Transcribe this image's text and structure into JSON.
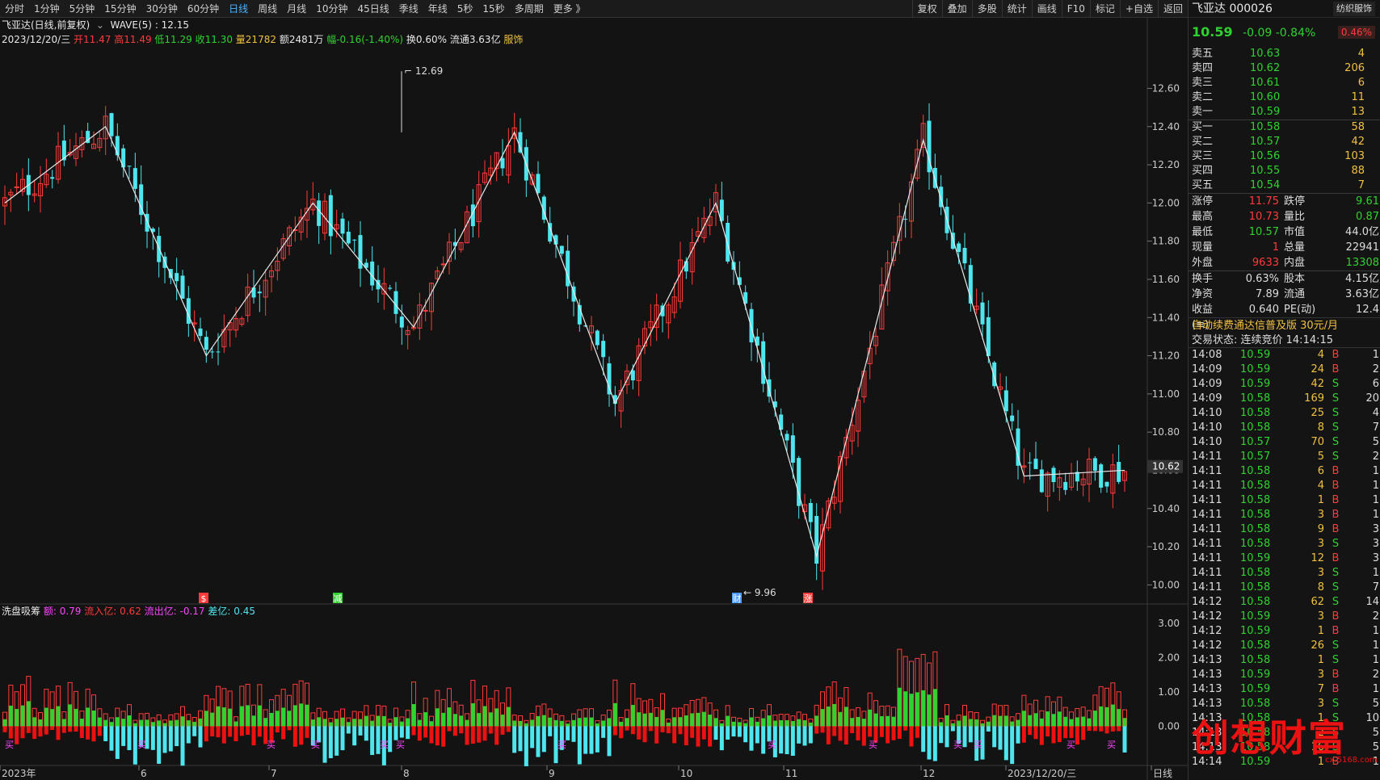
{
  "toolbar": {
    "left_tabs": [
      "分时",
      "1分钟",
      "5分钟",
      "15分钟",
      "30分钟",
      "60分钟",
      "日线",
      "周线",
      "月线",
      "10分钟",
      "45日线",
      "季线",
      "年线",
      "5秒",
      "15秒",
      "多周期",
      "更多 》"
    ],
    "active_tab": "日线",
    "right_tabs": [
      "复权",
      "叠加",
      "多股",
      "统计",
      "画线",
      "F10",
      "标记",
      "+自选",
      "返回"
    ]
  },
  "header": {
    "title": "飞亚达(日线,前复权)",
    "indicator": "WAVE(5)",
    "indicator_value": ": 12.15",
    "date": "2023/12/20/三",
    "open": "开11.47",
    "high": "高11.49",
    "low": "低11.29",
    "close": "收11.30",
    "volume": "量21782",
    "amount": "额2481万",
    "change": "幅-0.16(-1.40%)",
    "turnover": "换0.60%",
    "float": "流通3.63亿",
    "sector": "服饰"
  },
  "indicator_header": {
    "name": "洗盘吸筹",
    "e": "额: 0.79",
    "inflow": "流入亿: 0.62",
    "outflow": "流出亿: -0.17",
    "diff": "差亿: 0.45"
  },
  "chart_data": {
    "type": "candlestick",
    "price_axis": [
      "12.60",
      "12.40",
      "12.20",
      "12.00",
      "11.80",
      "11.60",
      "11.40",
      "11.20",
      "11.00",
      "10.80",
      "10.60",
      "10.40",
      "10.20",
      "10.00"
    ],
    "ylim": [
      9.9,
      12.75
    ],
    "current_price_tag": "10.62",
    "high_label": "12.69",
    "low_label": "9.96",
    "x_labels": [
      "2023年",
      "6",
      "7",
      "8",
      "9",
      "10",
      "11",
      "12",
      "2023/12/20/三",
      "日线"
    ],
    "indicator_axis": [
      "3.00",
      "2.00",
      "1.00",
      "0.00"
    ],
    "indicator_ylim": [
      -1.1,
      3.1
    ],
    "markers": [
      "$",
      "减",
      "财",
      "涨"
    ],
    "buy_label": "买",
    "wave_points": [
      12.0,
      12.4,
      11.2,
      12.0,
      11.35,
      12.37,
      10.95,
      12.0,
      10.15,
      12.33,
      10.57,
      10.6
    ]
  },
  "quote": {
    "name": "飞亚达 000026",
    "industry": "纺织服饰",
    "price": "10.59",
    "change": "-0.09",
    "pct": "-0.84%",
    "badge": "0.46%"
  },
  "asks": [
    {
      "label": "卖五",
      "price": "10.63",
      "vol": "4"
    },
    {
      "label": "卖四",
      "price": "10.62",
      "vol": "206"
    },
    {
      "label": "卖三",
      "price": "10.61",
      "vol": "6"
    },
    {
      "label": "卖二",
      "price": "10.60",
      "vol": "11"
    },
    {
      "label": "卖一",
      "price": "10.59",
      "vol": "13"
    }
  ],
  "bids": [
    {
      "label": "买一",
      "price": "10.58",
      "vol": "58"
    },
    {
      "label": "买二",
      "price": "10.57",
      "vol": "42"
    },
    {
      "label": "买三",
      "price": "10.56",
      "vol": "103"
    },
    {
      "label": "买四",
      "price": "10.55",
      "vol": "88"
    },
    {
      "label": "买五",
      "price": "10.54",
      "vol": "7"
    }
  ],
  "stats": [
    {
      "k": "涨停",
      "v": "11.75",
      "vc": "red",
      "k2": "跌停",
      "v2": "9.61",
      "v2c": "green"
    },
    {
      "k": "最高",
      "v": "10.73",
      "vc": "red",
      "k2": "量比",
      "v2": "0.87",
      "v2c": "green"
    },
    {
      "k": "最低",
      "v": "10.57",
      "vc": "green",
      "k2": "市值",
      "v2": "44.0亿",
      "v2c": "white"
    },
    {
      "k": "现量",
      "v": "1",
      "vc": "red",
      "k2": "总量",
      "v2": "22941",
      "v2c": "white"
    },
    {
      "k": "外盘",
      "v": "9633",
      "vc": "red",
      "k2": "内盘",
      "v2": "13308",
      "v2c": "green"
    }
  ],
  "stats2": [
    {
      "k": "换手",
      "v": "0.63%",
      "k2": "股本",
      "v2": "4.15亿"
    },
    {
      "k": "净资",
      "v": "7.89",
      "k2": "流通",
      "v2": "3.63亿"
    },
    {
      "k": "收益(≡)",
      "v": "0.640",
      "k2": "PE(动)",
      "v2": "12.4"
    }
  ],
  "promo": "自动续费通达信普及版  30元/月",
  "trade_state": "交易状态: 连续竞价 14:14:15",
  "ticks": [
    {
      "t": "14:08",
      "p": "10.59",
      "q": "4",
      "s": "B",
      "x": "1"
    },
    {
      "t": "14:09",
      "p": "10.59",
      "q": "24",
      "s": "B",
      "x": "2"
    },
    {
      "t": "14:09",
      "p": "10.59",
      "q": "42",
      "s": "S",
      "x": "6"
    },
    {
      "t": "14:09",
      "p": "10.58",
      "q": "169",
      "s": "S",
      "x": "20"
    },
    {
      "t": "14:10",
      "p": "10.58",
      "q": "25",
      "s": "S",
      "x": "4"
    },
    {
      "t": "14:10",
      "p": "10.58",
      "q": "8",
      "s": "S",
      "x": "7"
    },
    {
      "t": "14:10",
      "p": "10.57",
      "q": "70",
      "s": "S",
      "x": "5"
    },
    {
      "t": "14:11",
      "p": "10.57",
      "q": "5",
      "s": "S",
      "x": "2"
    },
    {
      "t": "14:11",
      "p": "10.58",
      "q": "6",
      "s": "B",
      "x": "1"
    },
    {
      "t": "14:11",
      "p": "10.58",
      "q": "4",
      "s": "B",
      "x": "1"
    },
    {
      "t": "14:11",
      "p": "10.58",
      "q": "1",
      "s": "B",
      "x": "1"
    },
    {
      "t": "14:11",
      "p": "10.58",
      "q": "3",
      "s": "B",
      "x": "1"
    },
    {
      "t": "14:11",
      "p": "10.58",
      "q": "9",
      "s": "B",
      "x": "3"
    },
    {
      "t": "14:11",
      "p": "10.58",
      "q": "3",
      "s": "S",
      "x": "3"
    },
    {
      "t": "14:11",
      "p": "10.59",
      "q": "12",
      "s": "B",
      "x": "3"
    },
    {
      "t": "14:11",
      "p": "10.58",
      "q": "3",
      "s": "S",
      "x": "1"
    },
    {
      "t": "14:11",
      "p": "10.58",
      "q": "8",
      "s": "S",
      "x": "7"
    },
    {
      "t": "14:12",
      "p": "10.58",
      "q": "62",
      "s": "S",
      "x": "14"
    },
    {
      "t": "14:12",
      "p": "10.59",
      "q": "3",
      "s": "B",
      "x": "2"
    },
    {
      "t": "14:12",
      "p": "10.59",
      "q": "1",
      "s": "B",
      "x": "1"
    },
    {
      "t": "14:12",
      "p": "10.58",
      "q": "26",
      "s": "S",
      "x": "1"
    },
    {
      "t": "14:13",
      "p": "10.58",
      "q": "1",
      "s": "S",
      "x": "1"
    },
    {
      "t": "14:13",
      "p": "10.59",
      "q": "3",
      "s": "B",
      "x": "2"
    },
    {
      "t": "14:13",
      "p": "10.59",
      "q": "7",
      "s": "B",
      "x": "1"
    },
    {
      "t": "14:13",
      "p": "10.58",
      "q": "3",
      "s": "S",
      "x": "5"
    },
    {
      "t": "14:13",
      "p": "10.58",
      "q": "1",
      "s": "S",
      "x": "10"
    },
    {
      "t": "14:13",
      "p": "10.58",
      "q": "2",
      "s": "S",
      "x": "5"
    },
    {
      "t": "14:13",
      "p": "10.58",
      "q": "16",
      "s": "S",
      "x": "5"
    },
    {
      "t": "14:14",
      "p": "10.59",
      "q": "1",
      "s": "B",
      "x": "1"
    }
  ],
  "watermark": "创想财富",
  "watermark_url": "cx.5168.com",
  "colors": {
    "up": "#ff3b3b",
    "down": "#4ee6ee",
    "green": "#2fd32f",
    "wave": "#e8e8e8"
  }
}
